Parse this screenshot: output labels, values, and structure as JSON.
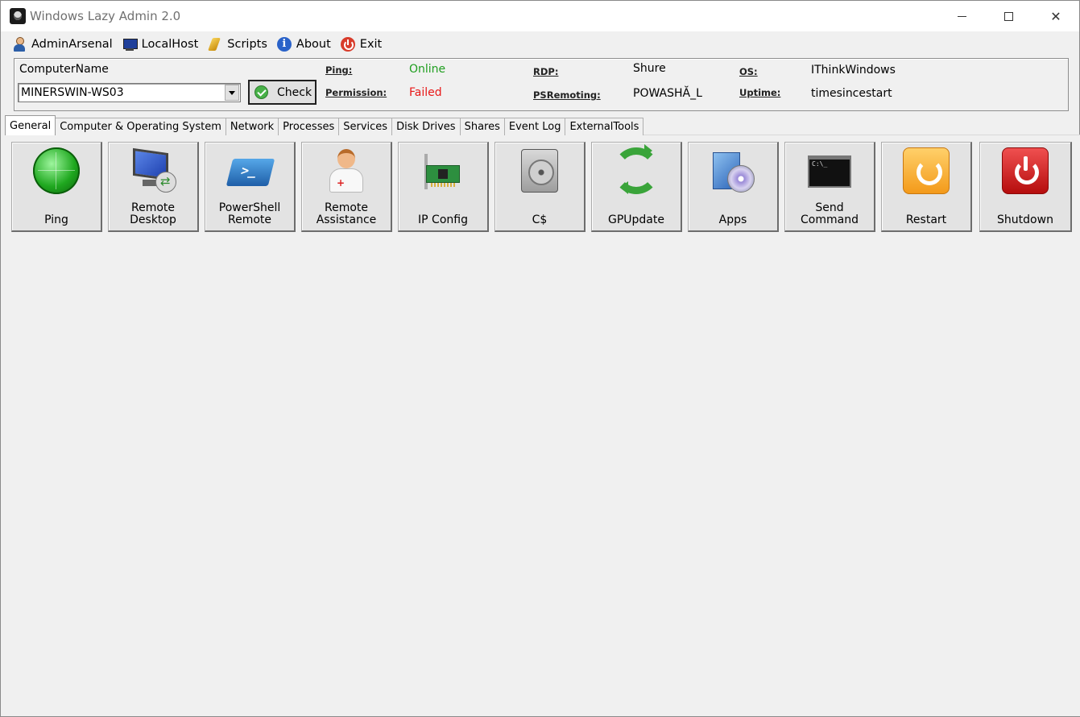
{
  "window": {
    "title": "Windows Lazy Admin 2.0",
    "controls": {
      "minimize": "minimize",
      "maximize": "maximize",
      "close": "✕"
    }
  },
  "menu": [
    {
      "label": "AdminArsenal",
      "icon": "user-icon"
    },
    {
      "label": "LocalHost",
      "icon": "computer-icon"
    },
    {
      "label": "Scripts",
      "icon": "scripts-icon"
    },
    {
      "label": "About",
      "icon": "info-icon",
      "glyph": "i"
    },
    {
      "label": "Exit",
      "icon": "power-icon"
    }
  ],
  "info": {
    "computer_name_label": "ComputerName",
    "computer_name_value": "MINERSWIN-WS03",
    "check_label": "Check",
    "ping_key": "Ping:",
    "ping_value": "Online",
    "permission_key": "Permission:",
    "permission_value": "Failed",
    "rdp_key": "RDP:",
    "rdp_value": "Shure",
    "psremoting_key": "PSRemoting:",
    "psremoting_value": "POWASHĂ_L",
    "os_key": "OS:",
    "os_value": "IThinkWindows",
    "uptime_key": "Uptime:",
    "uptime_value": "timesincestart",
    "colors": {
      "online": "#1f9e1f",
      "failed": "#e81818"
    }
  },
  "tabs": [
    {
      "label": "General",
      "active": true
    },
    {
      "label": "Computer & Operating System"
    },
    {
      "label": "Network"
    },
    {
      "label": "Processes"
    },
    {
      "label": "Services"
    },
    {
      "label": "Disk Drives"
    },
    {
      "label": "Shares"
    },
    {
      "label": "Event Log"
    },
    {
      "label": "ExternalTools"
    }
  ],
  "tools": [
    {
      "line1": "",
      "line2": "Ping",
      "icon": "ping-radar-icon"
    },
    {
      "line1": "Remote",
      "line2": "Desktop",
      "icon": "remote-desktop-icon"
    },
    {
      "line1": "PowerShell",
      "line2": "Remote",
      "icon": "powershell-icon"
    },
    {
      "line1": "Remote",
      "line2": "Assistance",
      "icon": "doctor-icon"
    },
    {
      "line1": "",
      "line2": "IP Config",
      "icon": "network-card-icon"
    },
    {
      "line1": "",
      "line2": "C$",
      "icon": "hard-disk-icon"
    },
    {
      "line1": "",
      "line2": "GPUpdate",
      "icon": "refresh-arrows-icon"
    },
    {
      "line1": "",
      "line2": "Apps",
      "icon": "software-box-icon"
    },
    {
      "line1": "Send",
      "line2": "Command",
      "icon": "command-prompt-icon"
    },
    {
      "line1": "",
      "line2": "Restart",
      "icon": "restart-icon"
    },
    {
      "line1": "",
      "line2": "Shutdown",
      "icon": "shutdown-icon"
    }
  ]
}
